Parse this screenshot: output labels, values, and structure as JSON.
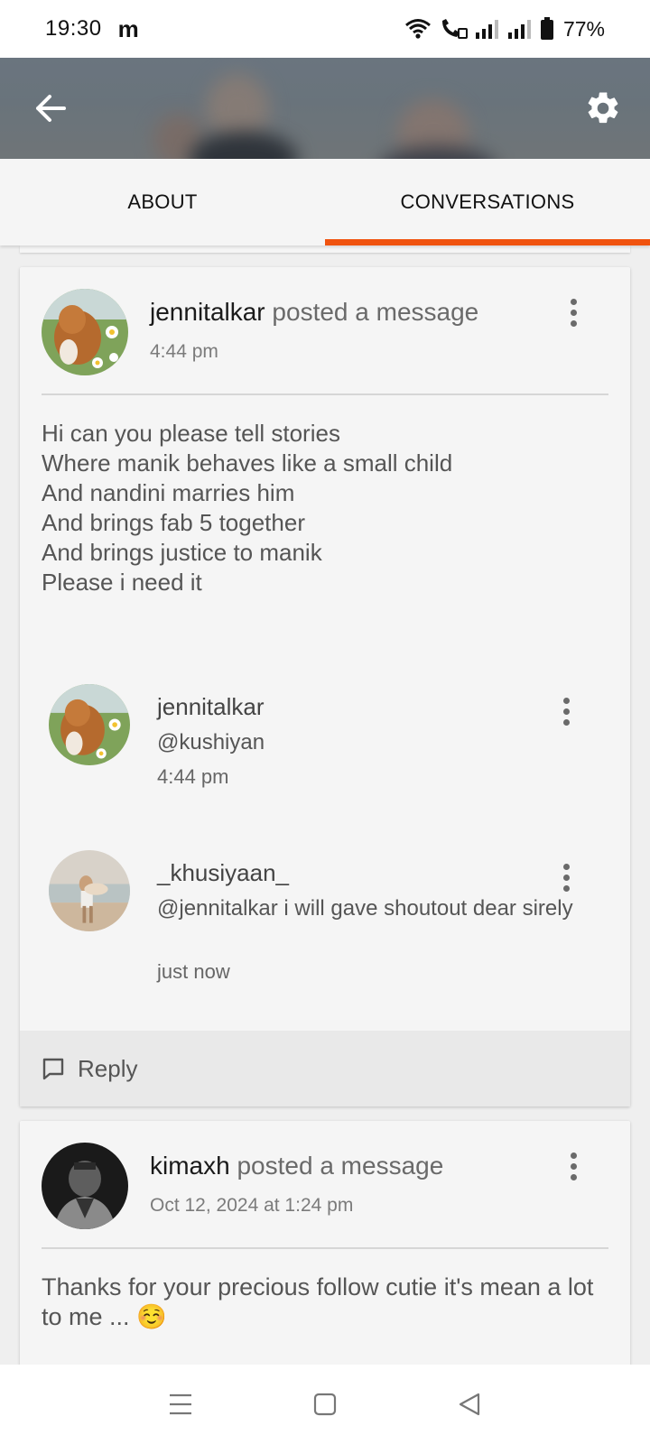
{
  "status_bar": {
    "time": "19:30",
    "app_glyph": "m",
    "battery": "77%",
    "icons": [
      "wifi-icon",
      "wifi-call-icon",
      "signal-icon",
      "signal-icon",
      "battery-icon"
    ]
  },
  "header": {
    "back_icon": "arrow-left-icon",
    "settings_icon": "gear-icon"
  },
  "tabs": [
    {
      "label": "ABOUT",
      "active": false
    },
    {
      "label": "CONVERSATIONS",
      "active": true
    }
  ],
  "accent_color": "#f0530f",
  "posts": [
    {
      "author": "jennitalkar",
      "action": " posted a message",
      "time": "4:44 pm",
      "body_lines": [
        "Hi can you please tell stories",
        "Where manik behaves like a small child",
        "And nandini marries him",
        "And brings fab 5 together",
        "And brings justice to manik",
        "Please i need it"
      ],
      "replies": [
        {
          "name": "jennitalkar",
          "text": "@kushiyan",
          "time": "4:44 pm"
        },
        {
          "name": "_khusiyaan_",
          "text": "@jennitalkar  i will gave shoutout dear sirely",
          "time": "just now"
        }
      ],
      "reply_label": "Reply"
    },
    {
      "author": "kimaxh",
      "action": " posted a message",
      "time": "Oct 12, 2024 at 1:24 pm",
      "body": "Thanks for your precious follow cutie it's mean a lot to me ... ☺️"
    }
  ],
  "nav": [
    "menu-icon",
    "home-square-icon",
    "back-triangle-icon"
  ]
}
